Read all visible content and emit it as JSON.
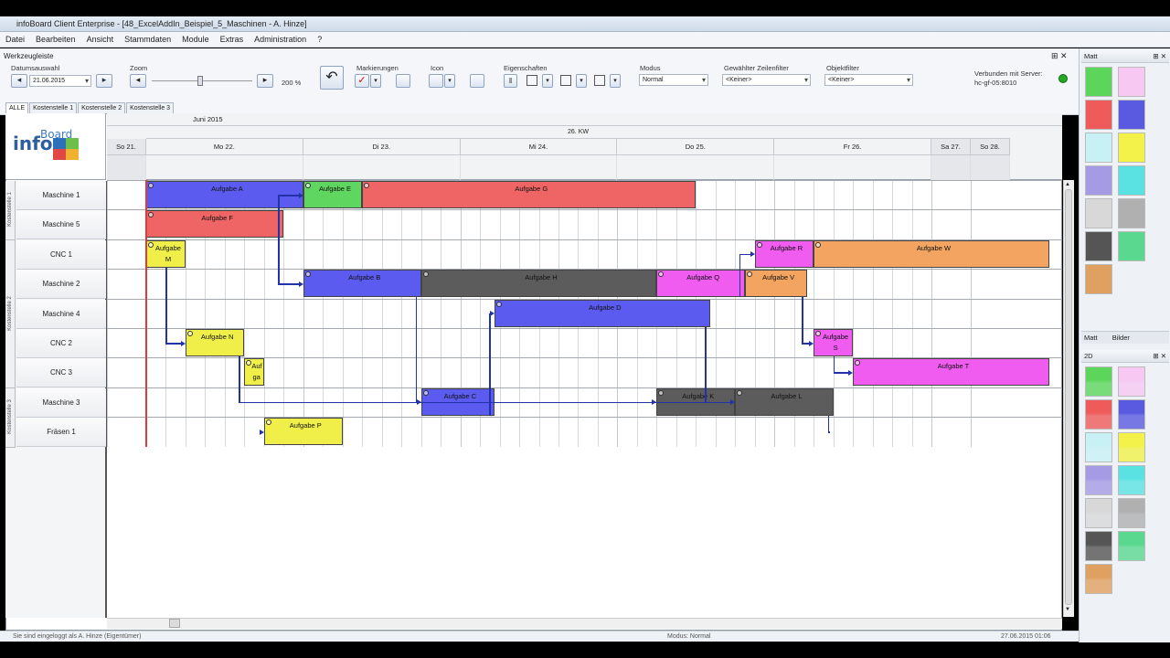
{
  "window": {
    "title": "infoBoard Client Enterprise - [48_ExcelAddIn_Beispiel_5_Maschinen - A. Hinze]"
  },
  "menu": [
    "Datei",
    "Bearbeiten",
    "Ansicht",
    "Stammdaten",
    "Module",
    "Extras",
    "Administration",
    "?"
  ],
  "toolbar": {
    "title": "Werkzeugleiste",
    "date_label": "Datumsauswahl",
    "date_value": "21.06.2015",
    "zoom_label": "Zoom",
    "zoom_value": "200 %",
    "markers_label": "Markierungen",
    "icon_label": "Icon",
    "props_label": "Eigenschaften",
    "mode_label": "Modus",
    "mode_value": "Normal",
    "rowfilter_label": "Gewählter Zeilenfilter",
    "rowfilter_value": "<Keiner>",
    "objfilter_label": "Objektfilter",
    "objfilter_value": "<Keiner>",
    "server_label": "Verbunden mit Server:",
    "server_value": "hc-gf-05:8010",
    "colors": {
      "red": "#d40000",
      "blue": "#3355cc",
      "green": "#118811",
      "status": "#22aa22"
    }
  },
  "tabs": [
    "ALLE",
    "Kostenstelle 1",
    "Kostenstelle 2",
    "Kostenstelle 3"
  ],
  "header": {
    "month": "Juni 2015",
    "kw": "26. KW",
    "days": [
      "So 21.",
      "Mo 22.",
      "Di 23.",
      "Mi 24.",
      "Do 25.",
      "Fr 26.",
      "Sa 27.",
      "So 28."
    ]
  },
  "groups": [
    "Kostenstelle 1",
    "Kostenstelle 2",
    "Kostenstelle 3"
  ],
  "rows": [
    "Maschine 1",
    "Maschine 5",
    "CNC 1",
    "Maschine 2",
    "Maschine 4",
    "CNC 2",
    "CNC 3",
    "Maschine 3",
    "Fräsen 1"
  ],
  "task_colors": {
    "blue": "#5b5bef",
    "green": "#5fd65f",
    "red": "#ef6464",
    "yellow": "#f0ef4a",
    "gray": "#5c5c5c",
    "magenta": "#ef5cef",
    "orange": "#f2a460"
  },
  "tasks": [
    {
      "label": "Aufgabe A",
      "row": 0,
      "start": 1.0,
      "end": 2.0,
      "color": "blue"
    },
    {
      "label": "Aufgabe E",
      "row": 0,
      "start": 2.0,
      "end": 2.375,
      "color": "green"
    },
    {
      "label": "Aufgabe G",
      "row": 0,
      "start": 2.375,
      "end": 4.5,
      "color": "red"
    },
    {
      "label": "Aufgabe F",
      "row": 1,
      "start": 1.0,
      "end": 1.875,
      "color": "red"
    },
    {
      "label": "Aufgabe M",
      "row": 2,
      "start": 1.0,
      "end": 1.25,
      "color": "yellow"
    },
    {
      "label": "Aufgabe R",
      "row": 2,
      "start": 4.875,
      "end": 5.25,
      "color": "magenta"
    },
    {
      "label": "Aufgabe W",
      "row": 2,
      "start": 5.25,
      "end": 6.75,
      "color": "orange"
    },
    {
      "label": "Aufgabe B",
      "row": 3,
      "start": 2.0,
      "end": 2.75,
      "color": "blue"
    },
    {
      "label": "Aufgabe H",
      "row": 3,
      "start": 2.75,
      "end": 4.25,
      "color": "gray"
    },
    {
      "label": "Aufgabe Q",
      "row": 3,
      "start": 4.25,
      "end": 4.8125,
      "color": "magenta"
    },
    {
      "label": "Aufgabe V",
      "row": 3,
      "start": 4.8125,
      "end": 5.21,
      "color": "orange"
    },
    {
      "label": "Aufgabe D",
      "row": 4,
      "start": 3.2188,
      "end": 4.5938,
      "color": "blue"
    },
    {
      "label": "Aufgabe N",
      "row": 5,
      "start": 1.25,
      "end": 1.625,
      "color": "yellow"
    },
    {
      "label": "Aufgabe S",
      "row": 5,
      "start": 5.25,
      "end": 5.5,
      "color": "magenta"
    },
    {
      "label": "Auf ga be L",
      "row": 6,
      "start": 1.625,
      "end": 1.75,
      "color": "yellow"
    },
    {
      "label": "Aufgabe T",
      "row": 6,
      "start": 5.5,
      "end": 6.75,
      "color": "magenta"
    },
    {
      "label": "Aufgabe C",
      "row": 7,
      "start": 2.75,
      "end": 3.2188,
      "color": "blue"
    },
    {
      "label": "Aufgabe K",
      "row": 7,
      "start": 4.25,
      "end": 4.75,
      "color": "gray"
    },
    {
      "label": "Aufgabe L",
      "row": 7,
      "start": 4.75,
      "end": 5.375,
      "color": "gray"
    },
    {
      "label": "Aufgabe P",
      "row": 8,
      "start": 1.75,
      "end": 2.25,
      "color": "yellow"
    }
  ],
  "links": [
    [
      "Aufgabe F",
      "Aufgabe E"
    ],
    [
      "Aufgabe F",
      "Aufgabe B"
    ],
    [
      "Aufgabe M",
      "Aufgabe N"
    ],
    [
      "Aufgabe N",
      "Aufgabe L"
    ],
    [
      "Aufgabe L",
      "Aufgabe P"
    ],
    [
      "Aufgabe B",
      "Aufgabe C"
    ],
    [
      "Aufgabe C",
      "Aufgabe D"
    ],
    [
      "Aufgabe D",
      "Aufgabe K"
    ],
    [
      "Aufgabe Q",
      "Aufgabe R"
    ],
    [
      "Aufgabe V",
      "Aufgabe S"
    ],
    [
      "Aufgabe S",
      "Aufgabe T"
    ]
  ],
  "right_panel": {
    "top_header": "Matt",
    "tab_matt": "Matt",
    "tab_bilder": "Bilder",
    "bottom_header": "2D",
    "palette_top": [
      "#5bd65b",
      "#f6c8f2",
      "#ef5a5a",
      "#5a5ae0",
      "#c8f1f6",
      "#f2f24a",
      "#a49be4",
      "#5ae2e2",
      "#d8d8d8",
      "#b0b0b0",
      "#555555",
      "#5ad88f",
      "#e0a060"
    ],
    "palette_bottom": [
      "#5bd65b",
      "#f6c8f2",
      "#ef5a5a",
      "#5a5ae0",
      "#c8f1f6",
      "#f2f24a",
      "#a49be4",
      "#5ae2e2",
      "#d8d8d8",
      "#b0b0b0",
      "#555555",
      "#5ad88f",
      "#e0a060"
    ]
  },
  "status": {
    "left": "Sie sind eingeloggt als A. Hinze (Eigentümer)",
    "mode": "Modus: Normal",
    "time": "27.06.2015 01:06"
  }
}
